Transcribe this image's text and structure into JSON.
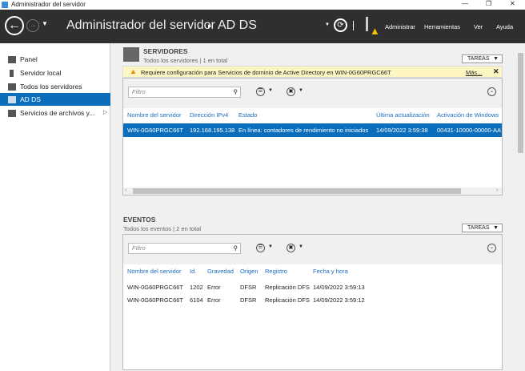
{
  "window": {
    "title": "Administrador del servidor",
    "min": "—",
    "max": "❐",
    "close": "✕"
  },
  "header": {
    "title": "Administrador del servidor",
    "separator": "▸",
    "page": "AD DS",
    "menu": [
      "Administrar",
      "Herramientas",
      "Ver",
      "Ayuda"
    ]
  },
  "sidebar": {
    "items": [
      {
        "label": "Panel"
      },
      {
        "label": "Servidor local"
      },
      {
        "label": "Todos los servidores"
      },
      {
        "label": "AD DS"
      },
      {
        "label": "Servicios de archivos y..."
      }
    ]
  },
  "servers": {
    "title": "SERVIDORES",
    "subtitle": "Todos los servidores | 1 en total",
    "tasks": "TAREAS",
    "alert": {
      "text": "Requiere configuración para Servicios de dominio de Active Directory en WIN-0G60PRGC66T",
      "more": "Más..."
    },
    "filter_placeholder": "Filtro",
    "columns": [
      "Nombre del servidor",
      "Dirección IPv4",
      "Estado",
      "Última actualización",
      "Activación de Windows"
    ],
    "rows": [
      [
        "WIN-0G60PRGC66T",
        "192.168.195.138",
        "En línea: contadores de rendimiento no iniciados",
        "14/09/2022 3:59:38",
        "00431-10000-00000-AA"
      ]
    ]
  },
  "events": {
    "title": "EVENTOS",
    "subtitle": "Todos los eventos | 2 en total",
    "tasks": "TAREAS",
    "filter_placeholder": "Filtro",
    "columns": [
      "Nombre del servidor",
      "Id.",
      "Gravedad",
      "Origen",
      "Registro",
      "Fecha y hora"
    ],
    "rows": [
      [
        "WIN-0G60PRGC66T",
        "1202",
        "Error",
        "DFSR",
        "Replicación DFS",
        "14/09/2022 3:59:13"
      ],
      [
        "WIN-0G60PRGC66T",
        "6104",
        "Error",
        "DFSR",
        "Replicación DFS",
        "14/09/2022 3:59:12"
      ]
    ]
  },
  "colors": {
    "accent": "#0a6ebd",
    "header": "#2f2f2f",
    "alert": "#fdf6c3"
  }
}
